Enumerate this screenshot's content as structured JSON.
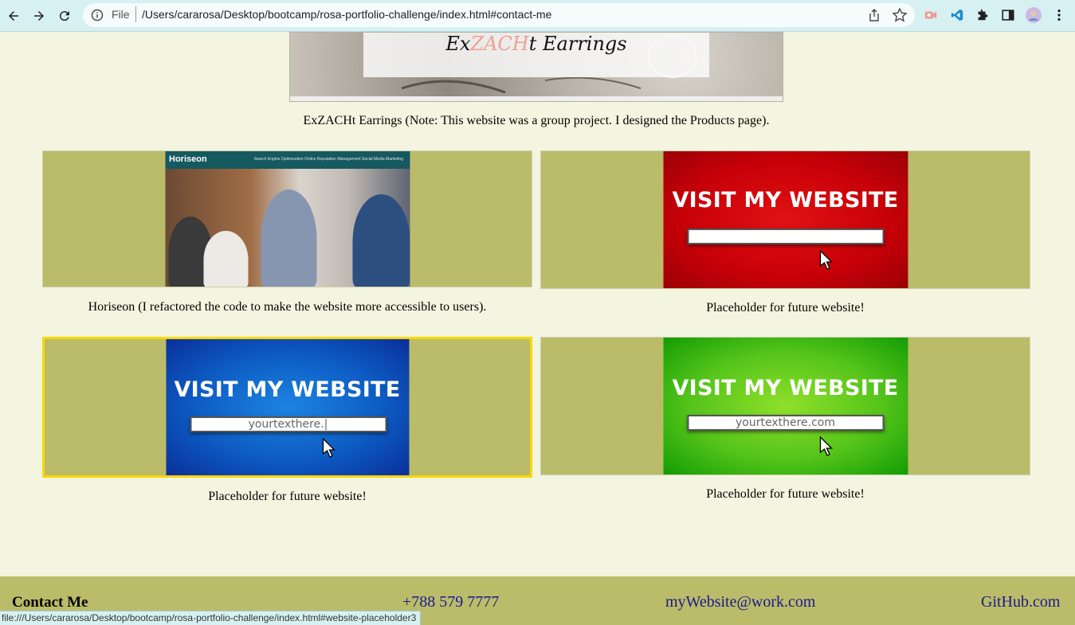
{
  "browser": {
    "scheme_label": "File",
    "url": "/Users/cararosa/Desktop/bootcamp/rosa-portfolio-challenge/index.html#contact-me",
    "status_url": "file:///Users/cararosa/Desktop/bootcamp/rosa-portfolio-challenge/index.html#website-placeholder3"
  },
  "hero": {
    "logo_prefix": "Ex",
    "logo_mid": "ZACH",
    "logo_suffix": "t Earrings",
    "caption": "ExZACHt Earrings (Note: This website was a group project. I designed the Products page)."
  },
  "projects": [
    {
      "thumb_title": "Horiseon",
      "thumb_nav": "Search Engine Optimization    Online Reputation Management    Social Media Marketing",
      "caption": "Horiseon (I refactored the code to make the website more accessible to users)."
    },
    {
      "thumb_title": "VISIT MY WEBSITE",
      "thumb_box_text": "",
      "caption": "Placeholder for future website!"
    },
    {
      "thumb_title": "VISIT MY WEBSITE",
      "thumb_box_text": "yourtexthere.|",
      "caption": "Placeholder for future website!"
    },
    {
      "thumb_title": "VISIT MY WEBSITE",
      "thumb_box_text": "yourtexthere.com",
      "caption": "Placeholder for future website!"
    }
  ],
  "footer": {
    "title": "Contact Me",
    "phone": "+788 579 7777",
    "email": "myWebsite@work.com",
    "github": "GitHub.com"
  },
  "colors": {
    "page_bg": "#f4f5e0",
    "card_bg": "#bbbc69",
    "focus_border": "#ffd700",
    "link": "#1a1a8a"
  }
}
